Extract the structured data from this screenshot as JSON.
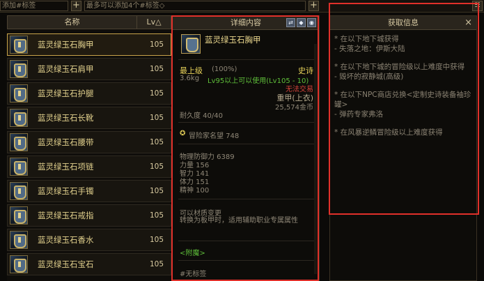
{
  "tagbar": {
    "left_value": "添加#标签",
    "right_value": "最多可以添加4个#标签◇"
  },
  "list": {
    "header_name": "名称",
    "header_lv": "Lv△",
    "items": [
      {
        "name": "蓝灵绿玉石胸甲",
        "lv": "105"
      },
      {
        "name": "蓝灵绿玉石肩甲",
        "lv": "105"
      },
      {
        "name": "蓝灵绿玉石护腿",
        "lv": "105"
      },
      {
        "name": "蓝灵绿玉石长靴",
        "lv": "105"
      },
      {
        "name": "蓝灵绿玉石腰带",
        "lv": "105"
      },
      {
        "name": "蓝灵绿玉石项链",
        "lv": "105"
      },
      {
        "name": "蓝灵绿玉石手镯",
        "lv": "105"
      },
      {
        "name": "蓝灵绿玉石戒指",
        "lv": "105"
      },
      {
        "name": "蓝灵绿玉石香水",
        "lv": "105"
      },
      {
        "name": "蓝灵绿玉石宝石",
        "lv": "105"
      }
    ]
  },
  "detail": {
    "title": "详细内容",
    "item_name": "蓝灵绿玉石胸甲",
    "grade": "最上级",
    "grade_pct": "(100%)",
    "rarity": "史诗",
    "weight": "3.6kg",
    "level_req": "Lv95以上可以使用(Lv105 - 10)",
    "trade": "无法交易",
    "type": "重甲(上衣)",
    "price": "25,574金币",
    "durability": "耐久度 40/40",
    "adventure": "冒险家名望 748",
    "stats": [
      "物理防御力 6389",
      "力量 156",
      "智力 141",
      "体力 151",
      "精神 100"
    ],
    "material_note": "可以材质变更",
    "convert_note": "转换为板甲时，适用辅助职业专属属性",
    "enchant": "<附魔>",
    "tag": "#无标签"
  },
  "info": {
    "title": "获取信息",
    "close_label": "×",
    "lines": [
      [
        "* 在以下地下城获得",
        "- 失落之地：伊斯大陆"
      ],
      [
        "* 在以下地下城的冒险级以上难度中获得",
        "- 毁坏的寂静城(高级)"
      ],
      [
        "* 在以下NPC商店兑换<定制史诗装备袖珍罐>",
        "- 弹药专家弗洛"
      ],
      [
        "* 在风暴逆鳞冒险级以上难度获得"
      ]
    ]
  },
  "colors": {
    "highlight_red": "#e0302a",
    "epic_gold": "#e8d25a",
    "usable_green": "#5fbf3a",
    "no_trade_red": "#d4433a"
  }
}
